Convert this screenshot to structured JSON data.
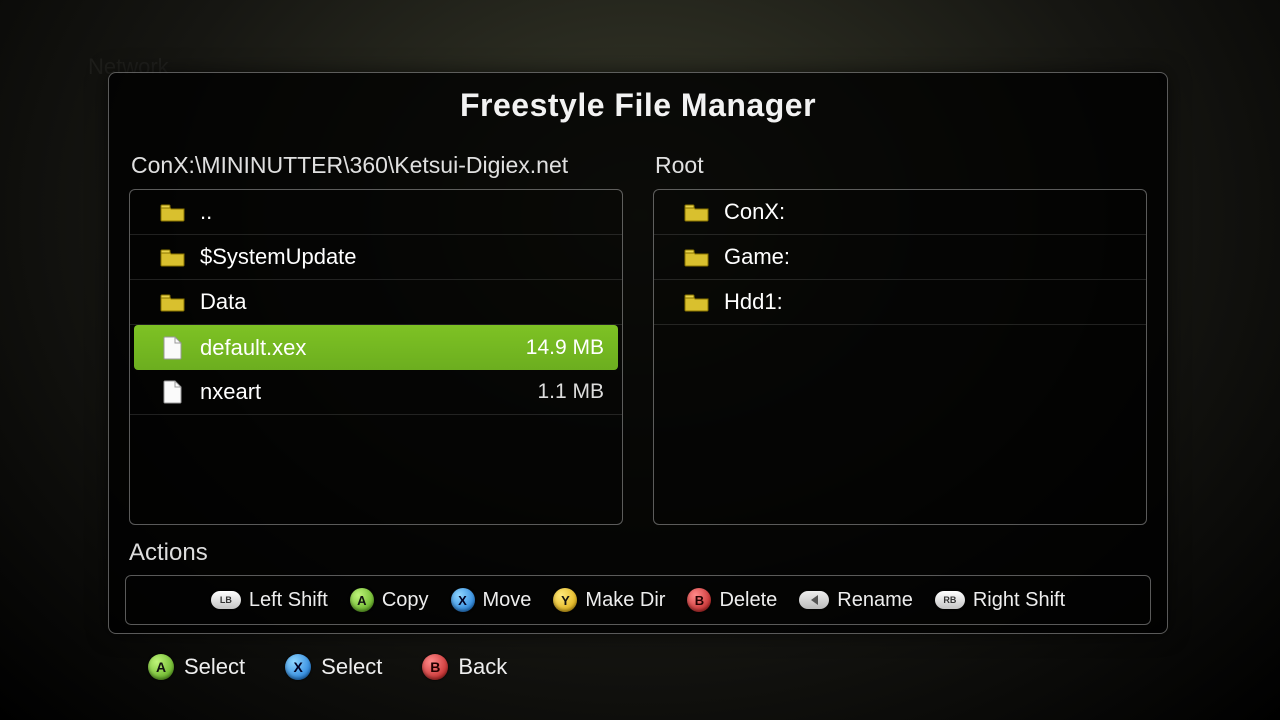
{
  "background_labels": {
    "network": "Network"
  },
  "title": "Freestyle File Manager",
  "left": {
    "path": "ConX:\\MININUTTER\\360\\Ketsui-Digiex.net",
    "items": [
      {
        "type": "folder",
        "name": "..",
        "size": "",
        "selected": false
      },
      {
        "type": "folder",
        "name": "$SystemUpdate",
        "size": "",
        "selected": false
      },
      {
        "type": "folder",
        "name": "Data",
        "size": "",
        "selected": false
      },
      {
        "type": "file",
        "name": "default.xex",
        "size": "14.9 MB",
        "selected": true
      },
      {
        "type": "file",
        "name": "nxeart",
        "size": "1.1 MB",
        "selected": false
      }
    ]
  },
  "right": {
    "path": "Root",
    "items": [
      {
        "type": "folder",
        "name": "ConX:",
        "size": "",
        "selected": false
      },
      {
        "type": "folder",
        "name": "Game:",
        "size": "",
        "selected": false
      },
      {
        "type": "folder",
        "name": "Hdd1:",
        "size": "",
        "selected": false
      }
    ]
  },
  "actions_label": "Actions",
  "actionbar": [
    {
      "icon": "bumper",
      "glyph": "LB",
      "label": "Left Shift"
    },
    {
      "icon": "face",
      "color": "green",
      "glyph": "A",
      "label": "Copy"
    },
    {
      "icon": "face",
      "color": "blue",
      "glyph": "X",
      "label": "Move"
    },
    {
      "icon": "face",
      "color": "yellow",
      "glyph": "Y",
      "label": "Make Dir"
    },
    {
      "icon": "face",
      "color": "red",
      "glyph": "B",
      "label": "Delete"
    },
    {
      "icon": "pill",
      "glyph": "",
      "label": "Rename"
    },
    {
      "icon": "bumper",
      "glyph": "RB",
      "label": "Right Shift"
    }
  ],
  "footer": [
    {
      "icon": "face",
      "color": "green",
      "glyph": "A",
      "label": "Select"
    },
    {
      "icon": "face",
      "color": "blue",
      "glyph": "X",
      "label": "Select"
    },
    {
      "icon": "face",
      "color": "red",
      "glyph": "B",
      "label": "Back"
    }
  ]
}
